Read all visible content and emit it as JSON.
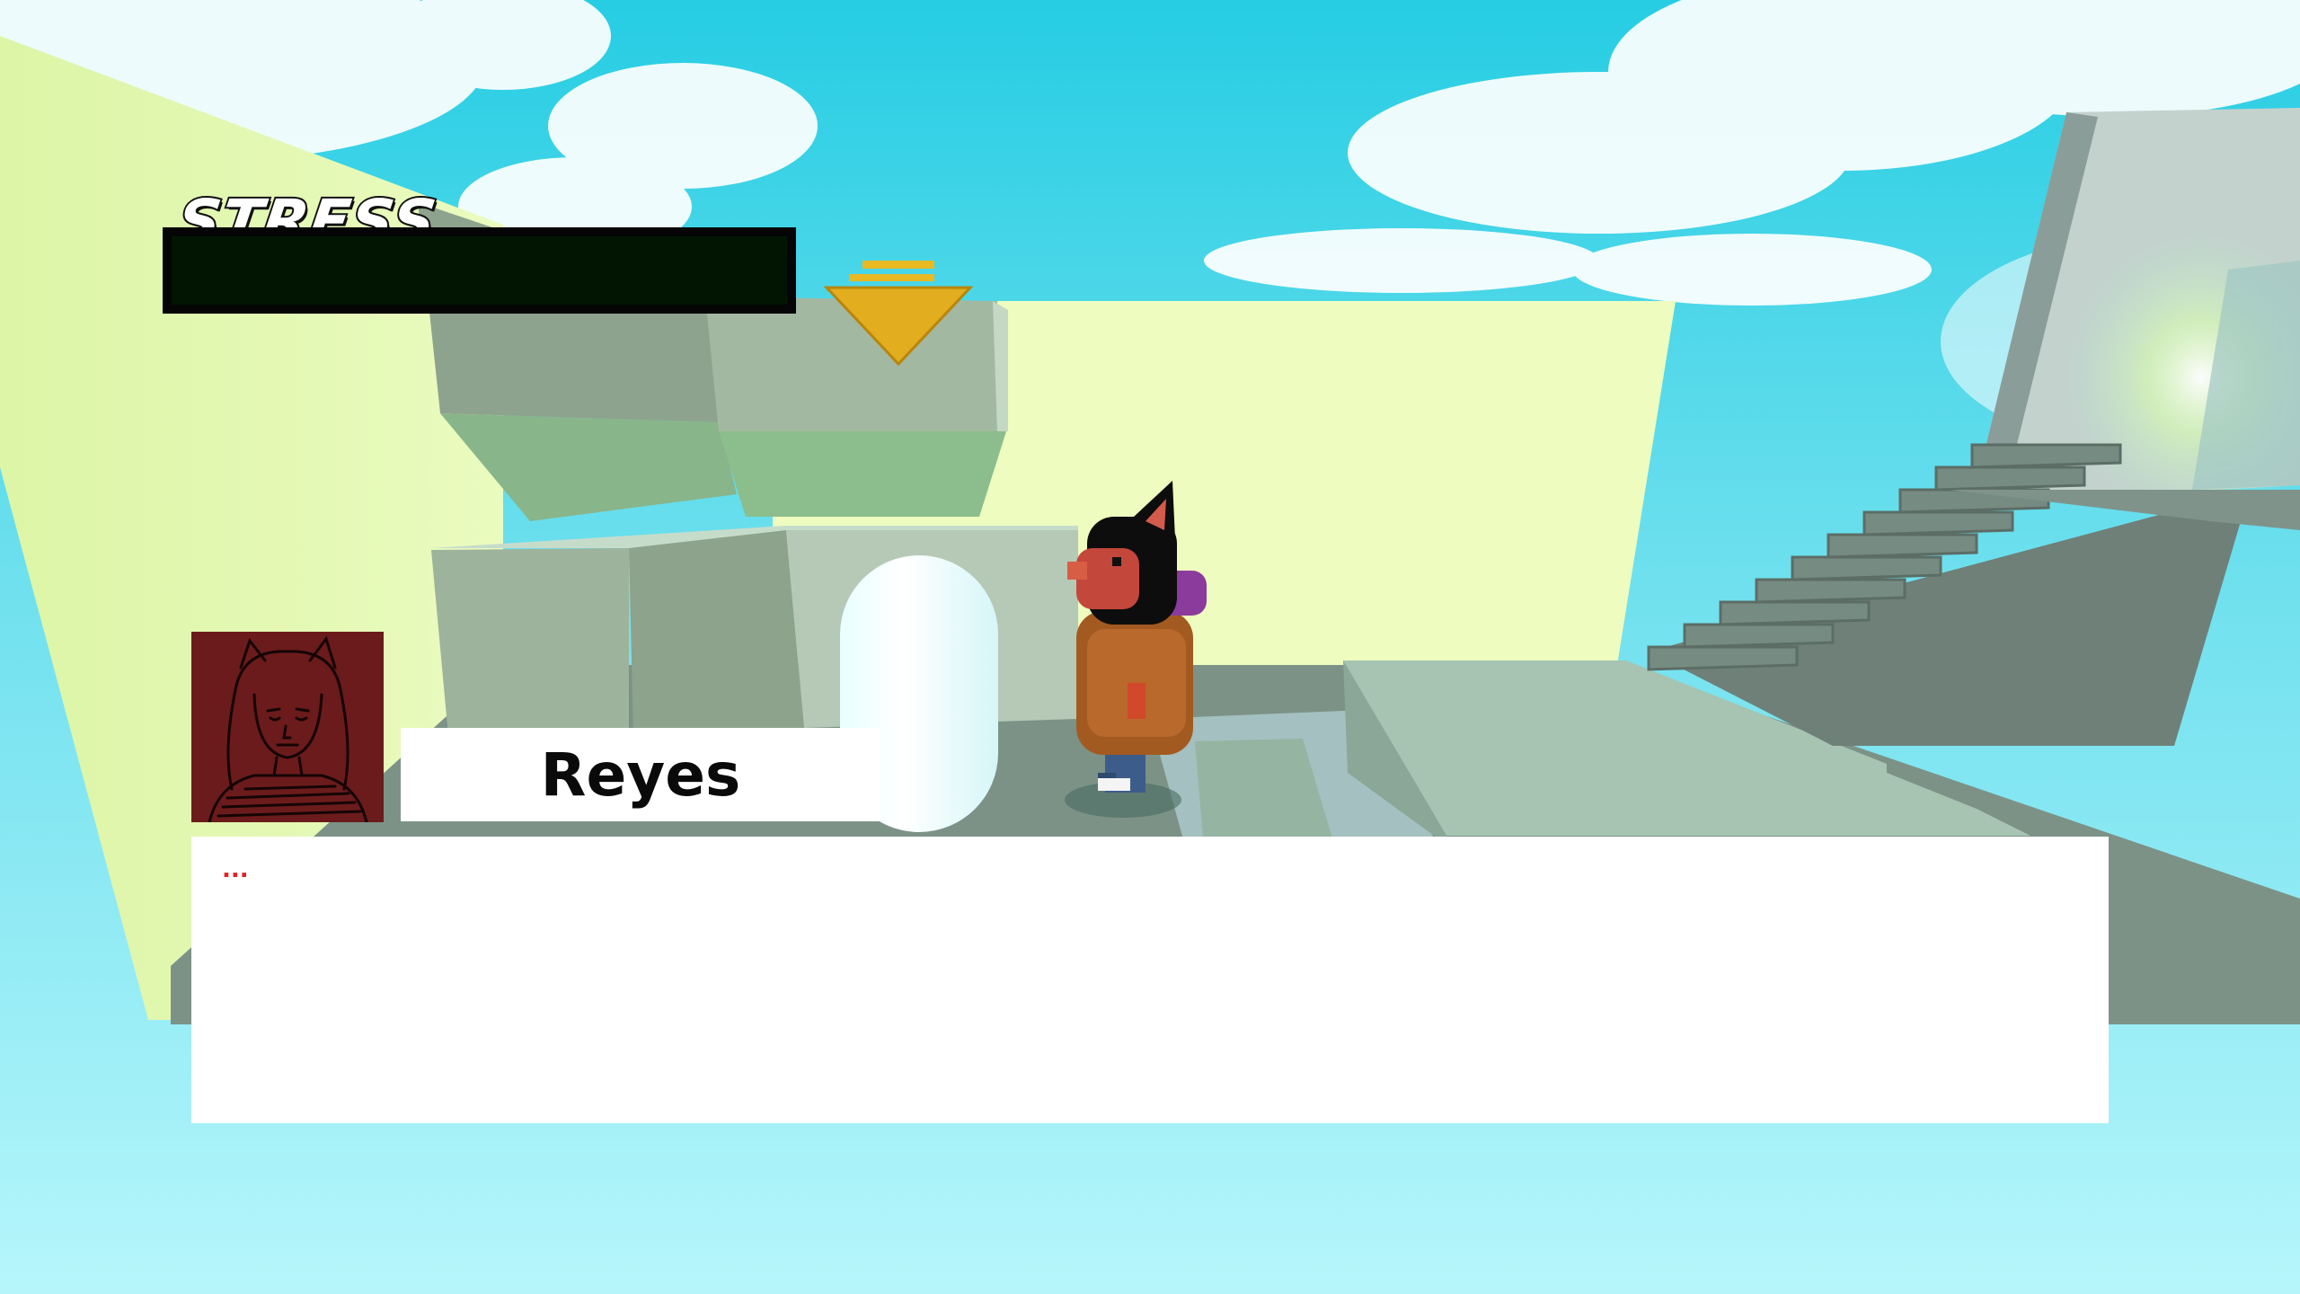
{
  "hud": {
    "stress_label": "STRESS",
    "stress_level": 0.0
  },
  "dialogue": {
    "speaker": "Reyes",
    "text": "..."
  },
  "colors": {
    "sky": "#2fd3e6",
    "stress_fill": "#2fbf49",
    "portrait_bg": "#6b1b1b",
    "dialogue_text": "#e32222"
  }
}
